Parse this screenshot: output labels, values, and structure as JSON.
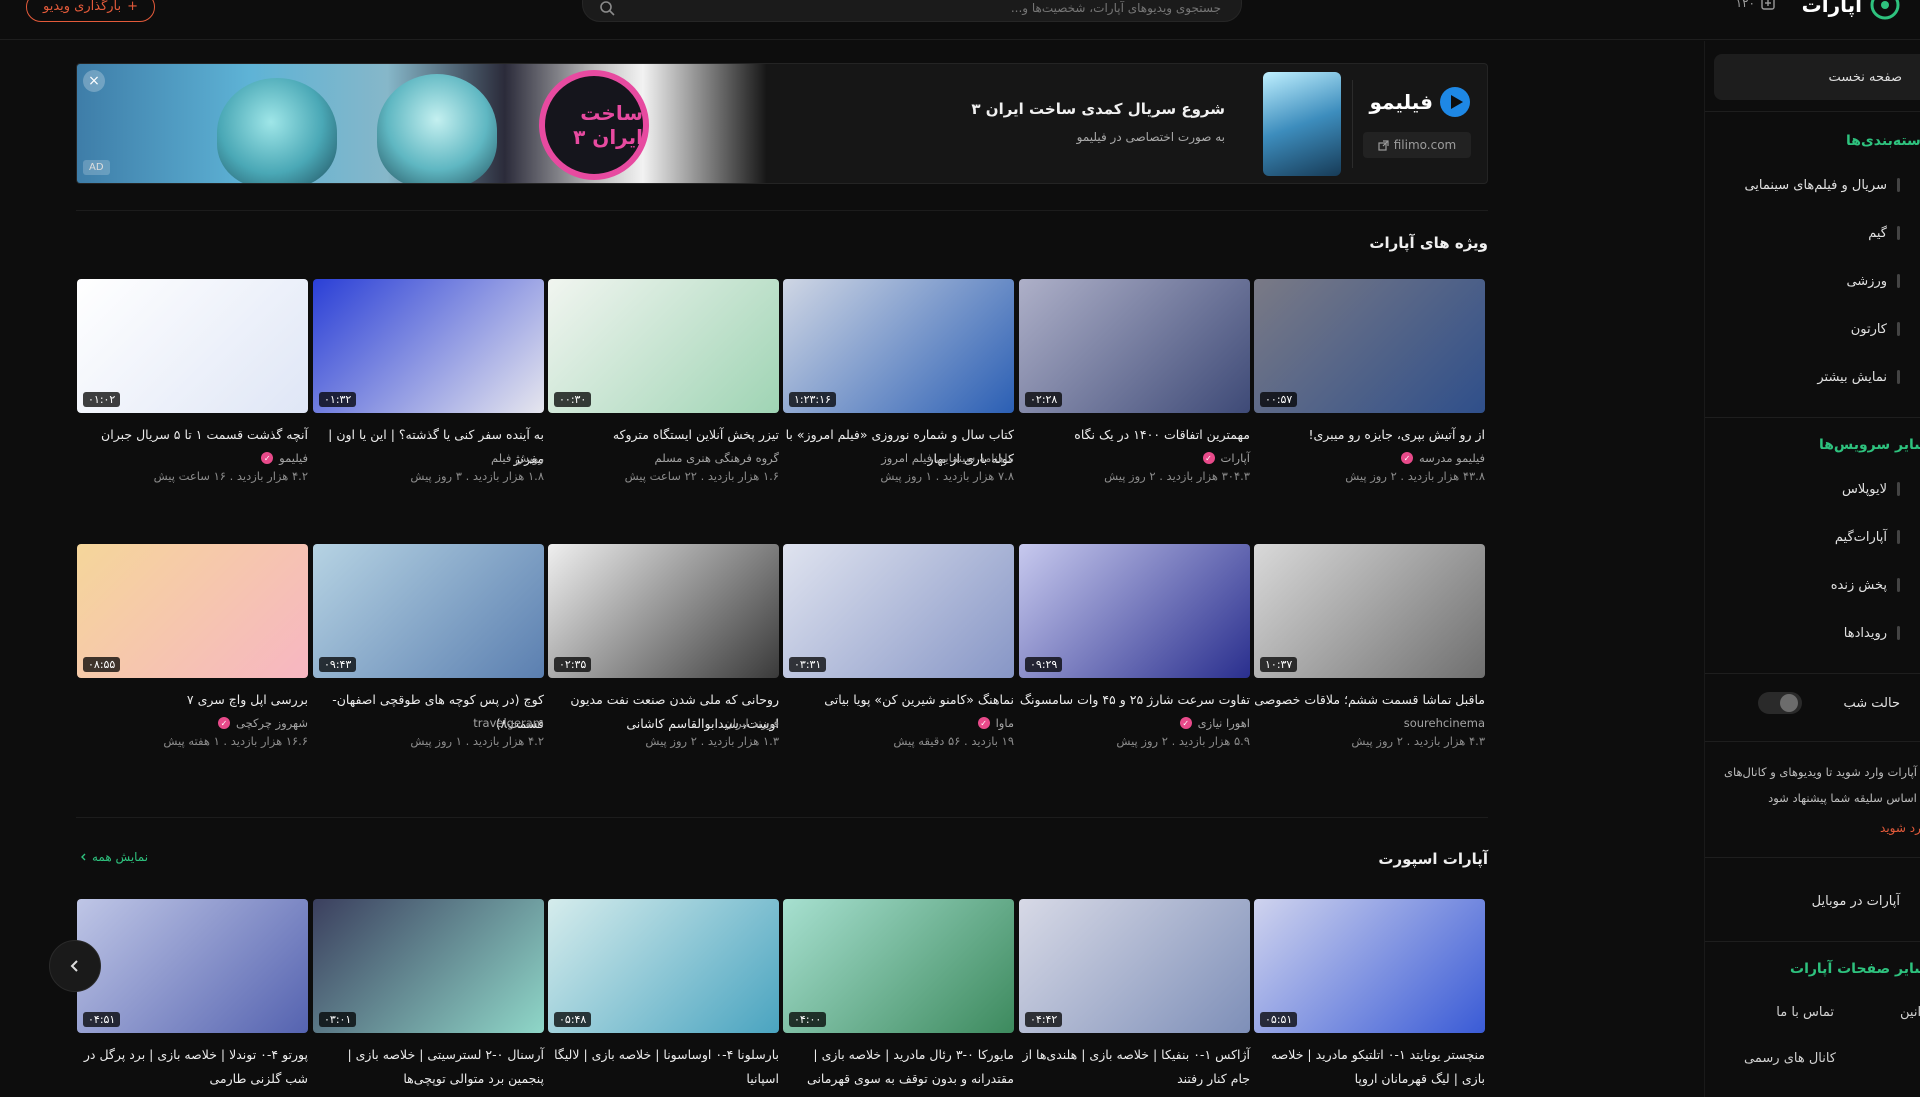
{
  "header": {
    "logo_text": "آپارات",
    "credits": "۱۲۰",
    "search_placeholder": "جستجوی ویدیوهای آپارات، شخصیت‌ها و...",
    "upload_label": "بارگذاری ویدیو",
    "upload_plus": "+"
  },
  "sidebar": {
    "home": "صفحه نخست",
    "categories_title": "دسته‌بندی‌ها",
    "categories": [
      "سریال و فیلم‌های سینمایی",
      "گیم",
      "ورزشی",
      "کارتون",
      "نمایش بیشتر"
    ],
    "services_title": "سایر سرویس‌ها",
    "services": [
      "لایوپلاس",
      "آپارات‌گیم",
      "پخش زنده",
      "رویدادها"
    ],
    "dark_mode": "حالت شب",
    "login_note_1": "به آپارات وارد شوید تا ویدیوهای و کانال‌های",
    "login_note_2": "بر اساس سلیقه شما پیشنهاد شود",
    "login_link": "وارد شوید",
    "mobile": "آپارات در موبایل",
    "pages_title": "سایر صفحات آپارات",
    "footer_links": [
      "تماس با ما",
      "کانال های رسمی",
      "قوانین"
    ]
  },
  "ad": {
    "close": "×",
    "tag": "AD",
    "circle_text": "ساخت ایران ۳",
    "title": "شروع سریال کمدی ساخت ایران ۳",
    "subtitle": "به صورت اختصاصی در فیلیمو",
    "brand": "فیلیمو",
    "link": "filimo.com"
  },
  "featured": {
    "title": "ویژه های آپارات",
    "videos": [
      {
        "title": "از رو آتیش بپری، جایزه رو میبری!",
        "channel": "فیلیمو مدرسه",
        "verified": true,
        "views": "۴۳.۸ هزار بازدید",
        "age": "۲ روز پیش",
        "duration": "۰۰:۵۷",
        "c1": "#7a7a86",
        "c2": "#2f4f8a"
      },
      {
        "title": "مهمترین اتفاقات ۱۴۰۰ در یک نگاه",
        "channel": "آپارات",
        "verified": true,
        "views": "۳۰۴.۳ هزار بازدید",
        "age": "۲ روز پیش",
        "duration": "۰۲:۲۸",
        "c1": "#aeb0c8",
        "c2": "#3e4a77"
      },
      {
        "title": "کتاب سال و شماره نوروزی «فیلم امروز» با کوله باری از بهار",
        "channel": "ماهنامه سینمایی فیلم امروز",
        "verified": false,
        "views": "۷.۸ هزار بازدید",
        "age": "۱ روز پیش",
        "duration": "۱:۲۳:۱۶",
        "c1": "#cfd6e4",
        "c2": "#2b5fb4"
      },
      {
        "title": "تیزر پخش آنلاین ایستگاه متروکه",
        "channel": "گروه فرهنگی هنری مسلم",
        "verified": false,
        "views": "۱.۶ هزار بازدید",
        "age": "۲۲ ساعت پیش",
        "duration": "۰۰:۳۰",
        "c1": "#f1f5f0",
        "c2": "#9fd4b4"
      },
      {
        "title": "به آینده سفر کنی یا گذشته؟ | این یا اون | مفرنژ",
        "channel": "رویش فیلم",
        "verified": false,
        "views": "۱.۸ هزار بازدید",
        "age": "۳ روز پیش",
        "duration": "۰۱:۳۲",
        "c1": "#2a3fd6",
        "c2": "#e6e6ee"
      },
      {
        "title": "آنچه گذشت قسمت ۱ تا ۵ سریال جبران",
        "channel": "فیلیمو",
        "verified": true,
        "views": "۴.۲ هزار بازدید",
        "age": "۱۶ ساعت پیش",
        "duration": "۰۱:۰۲",
        "c1": "#ffffff",
        "c2": "#dfe6f6"
      }
    ]
  },
  "featured_row2": {
    "videos": [
      {
        "title": "ماقبل تماشا قسمت ششم؛ ملاقات خصوصی",
        "channel": "sourehcinema",
        "verified": false,
        "views": "۴.۳ هزار بازدید",
        "age": "۲ روز پیش",
        "duration": "۱۰:۳۷",
        "c1": "#d9d9d9",
        "c2": "#6f6f6f"
      },
      {
        "title": "تفاوت سرعت شارژ ۲۵ و ۴۵ وات سامسونگ",
        "channel": "اهورا نیازی",
        "verified": true,
        "views": "۵.۹ هزار بازدید",
        "age": "۲ روز پیش",
        "duration": "۰۹:۲۹",
        "c1": "#c7c9ee",
        "c2": "#2a2f8e"
      },
      {
        "title": "نماهنگ «کامنو شیرین کن» پویا بیاتی",
        "channel": "ماوا",
        "verified": true,
        "views": "۱۹ بازدید",
        "age": "۵۶ دقیقه پیش",
        "duration": "۰۳:۳۱",
        "c1": "#dfe3ef",
        "c2": "#8796c6"
      },
      {
        "title": "روحانی که ملی شدن صنعت نفت مدیون اوست، سیدابوالقاسم کاشانی",
        "channel": "فرزند ایران",
        "verified": false,
        "views": "۱.۳ هزار بازدید",
        "age": "۲ روز پیش",
        "duration": "۰۲:۳۵",
        "c1": "#efefef",
        "c2": "#3a3a3a"
      },
      {
        "title": "کوچ (در پس کوچه های طوقچی اصفهان- قسمت۸)",
        "channel": "travelgeram",
        "verified": false,
        "views": "۴.۲ هزار بازدید",
        "age": "۱ روز پیش",
        "duration": "۰۹:۴۳",
        "c1": "#b6d3e3",
        "c2": "#5b7fb0"
      },
      {
        "title": "بررسی اپل واچ سری ۷",
        "channel": "شهروز چرکچی",
        "verified": true,
        "views": "۱۶.۶ هزار بازدید",
        "age": "۱ هفته پیش",
        "duration": "۰۸:۵۵",
        "c1": "#f5d69a",
        "c2": "#f7b6c2"
      }
    ]
  },
  "sport": {
    "title": "آپارات اسپورت",
    "see_all": "نمایش همه",
    "videos": [
      {
        "title": "منچستر یونایتد ۱-۰ اتلتیکو مادرید | خلاصه بازی | لیگ قهرمانان اروپا",
        "duration": "۰۵:۵۱",
        "c1": "#cfd3ee",
        "c2": "#3a5bd6"
      },
      {
        "title": "آژاکس ۱-۰ بنفیکا | خلاصه بازی | هلندی‌ها از جام کنار رفتند",
        "duration": "۰۴:۴۲",
        "c1": "#d7d9e6",
        "c2": "#7e8fb8"
      },
      {
        "title": "مایورکا ۰-۳ رئال مادرید | خلاصه بازی | مقتدرانه و بدون توقف به سوی قهرمانی",
        "duration": "۰۴:۰۰",
        "c1": "#a7e0d0",
        "c2": "#3d8a5e"
      },
      {
        "title": "بارسلونا ۴-۰ اوساسونا | خلاصه بازی | لالیگا اسپانیا",
        "duration": "۰۵:۴۸",
        "c1": "#d5ecec",
        "c2": "#4aa4c0"
      },
      {
        "title": "آرسنال ۰-۲ لسترسیتی | خلاصه بازی | پنجمین برد متوالی توپچی‌ها",
        "duration": "۰۳:۰۱",
        "c1": "#3b3f5e",
        "c2": "#8fd7c8"
      },
      {
        "title": "پورتو ۴-۰ توندلا | خلاصه بازی | برد پرگل در شب گلزنی طارمی",
        "duration": "۰۴:۵۱",
        "c1": "#bfc6e6",
        "c2": "#5563b0"
      }
    ]
  },
  "icons": {
    "search": "search-icon",
    "carousel_prev": "chevron-left-icon",
    "external": "external-link-icon"
  },
  "colors": {
    "accent_green": "#2ec27e",
    "accent_orange": "#e35a3a",
    "verified_pink": "#e84a8a",
    "background": "#0d0d0d"
  }
}
